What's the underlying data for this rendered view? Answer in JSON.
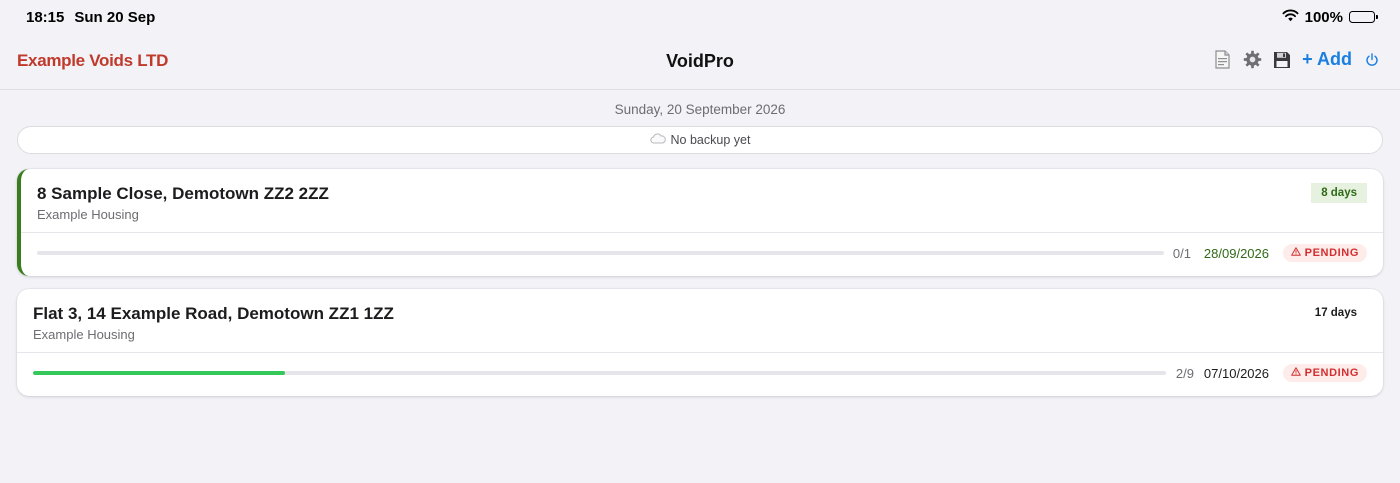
{
  "status_bar": {
    "time": "18:15",
    "date": "Sun 20 Sep",
    "battery": "100%"
  },
  "navbar": {
    "brand": "Example Voids LTD",
    "title": "VoidPro",
    "add_label": "+ Add",
    "icons": [
      "document-icon",
      "gear-icon",
      "save-icon",
      "power-icon"
    ],
    "accent_color": "#1a7fe0",
    "brand_color": "#c0392b"
  },
  "date_line": "Sunday, 20 September 2026",
  "backup": {
    "text": "No backup yet",
    "icon": "cloud-icon"
  },
  "properties": [
    {
      "address": "8 Sample Close, Demotown ZZ2 2ZZ",
      "client": "Example Housing",
      "days": "8 days",
      "progress_count": "0/1",
      "progress": 0.0,
      "due_date": "28/09/2026",
      "status": "PENDING"
    },
    {
      "address": "Flat 3, 14 Example Road, Demotown ZZ1 1ZZ",
      "client": "Example Housing",
      "days": "17 days",
      "progress_count": "2/9",
      "progress": 0.222,
      "due_date": "07/10/2026",
      "status": "PENDING"
    }
  ]
}
